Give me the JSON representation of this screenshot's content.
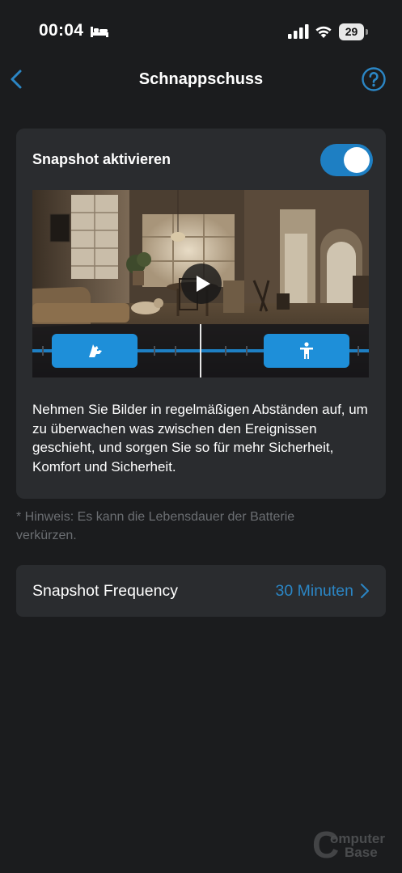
{
  "status_bar": {
    "time": "00:04",
    "battery_level": "29",
    "icons": [
      "bed-icon",
      "cellular-signal-icon",
      "wifi-icon",
      "battery-icon"
    ]
  },
  "nav": {
    "title": "Schnappschuss",
    "back_icon": "chevron-left-icon",
    "help_icon": "question-circle-icon"
  },
  "snapshot_card": {
    "title": "Snapshot aktivieren",
    "enabled": true,
    "preview": {
      "play_icon": "play-icon",
      "events": [
        {
          "icon": "pet-icon"
        },
        {
          "icon": "person-icon"
        }
      ]
    },
    "description": "Nehmen Sie Bilder in regelmäßigen Abständen auf, um zu überwachen was zwischen den Ereignissen geschieht, und sorgen Sie so für mehr Sicherheit, Komfort und Sicherheit."
  },
  "note": "* Hinweis: Es kann die Lebensdauer der Batterie verkürzen.",
  "frequency_row": {
    "label": "Snapshot Frequency",
    "value": "30 Minuten",
    "chevron_icon": "chevron-right-icon"
  },
  "watermark": {
    "line1": "omputer",
    "line2": "ase",
    "letter_c": "C",
    "letter_b": "B"
  },
  "colors": {
    "background": "#1b1c1e",
    "card": "#2a2c2f",
    "accent": "#1e7fc3",
    "accent_text": "#2b86c5",
    "note_text": "#6b6e72"
  }
}
